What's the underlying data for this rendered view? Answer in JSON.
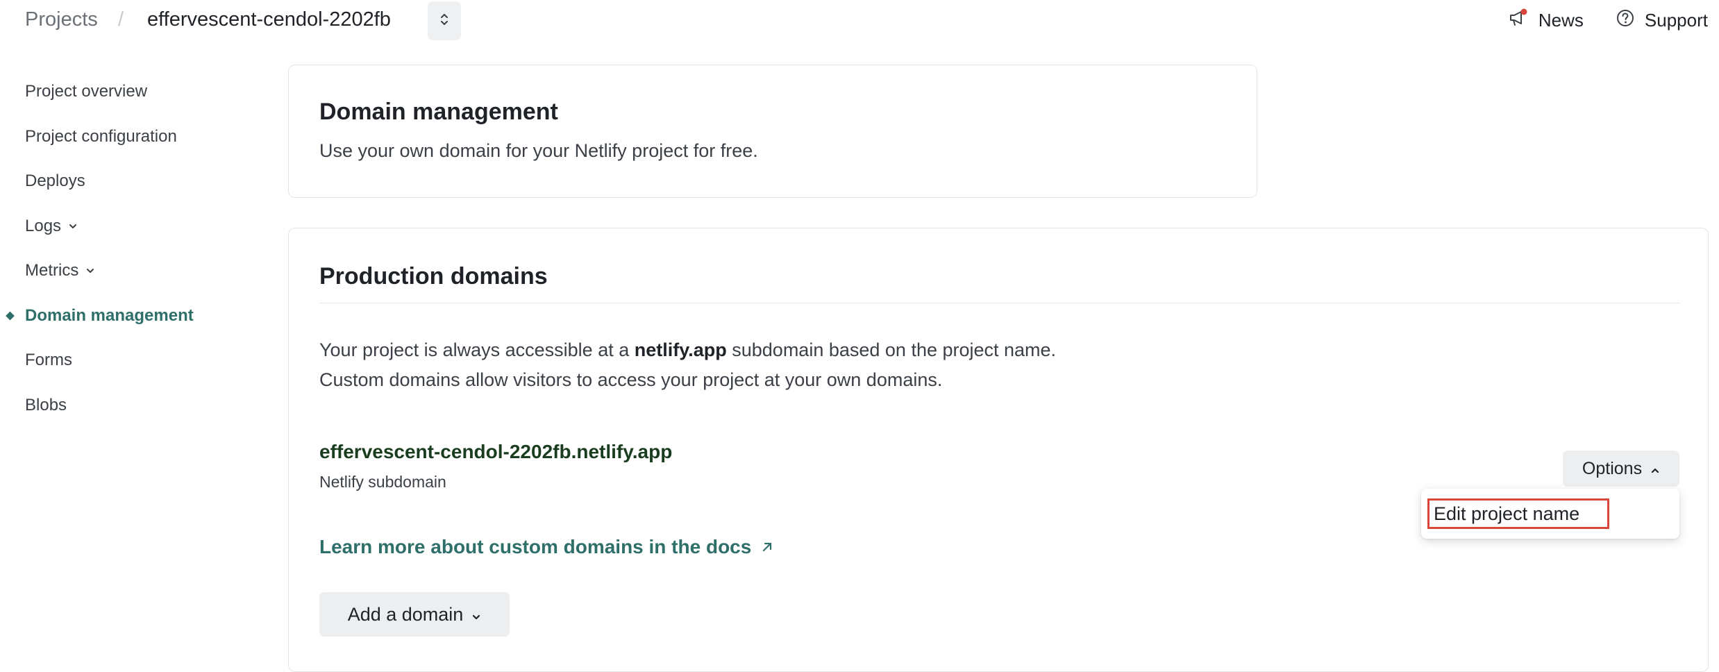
{
  "breadcrumb": {
    "projects": "Projects",
    "separator": "/",
    "site": "effervescent-cendol-2202fb"
  },
  "top_links": {
    "news": "News",
    "support": "Support"
  },
  "sidebar": {
    "items": [
      {
        "label": "Project overview"
      },
      {
        "label": "Project configuration"
      },
      {
        "label": "Deploys"
      },
      {
        "label": "Logs",
        "has_chevron": true
      },
      {
        "label": "Metrics",
        "has_chevron": true
      },
      {
        "label": "Domain management",
        "active": true
      },
      {
        "label": "Forms"
      },
      {
        "label": "Blobs"
      }
    ]
  },
  "domain_management_card": {
    "title": "Domain management",
    "description": "Use your own domain for your Netlify project for free."
  },
  "production_domains_card": {
    "title": "Production domains",
    "intro_part1": "Your project is always accessible at a ",
    "intro_bold": "netlify.app",
    "intro_part2": " subdomain based on the project name.",
    "intro_line2": "Custom domains allow visitors to access your project at your own domains.",
    "subdomain": "effervescent-cendol-2202fb.netlify.app",
    "subdomain_label": "Netlify subdomain",
    "options_label": "Options",
    "dropdown_item": "Edit project name",
    "docs_link": "Learn more about custom domains in the docs",
    "add_domain_label": "Add a domain"
  },
  "colors": {
    "accent": "#2f6f6a",
    "highlight_border": "#d9463b",
    "notification_dot": "#d9463b"
  }
}
